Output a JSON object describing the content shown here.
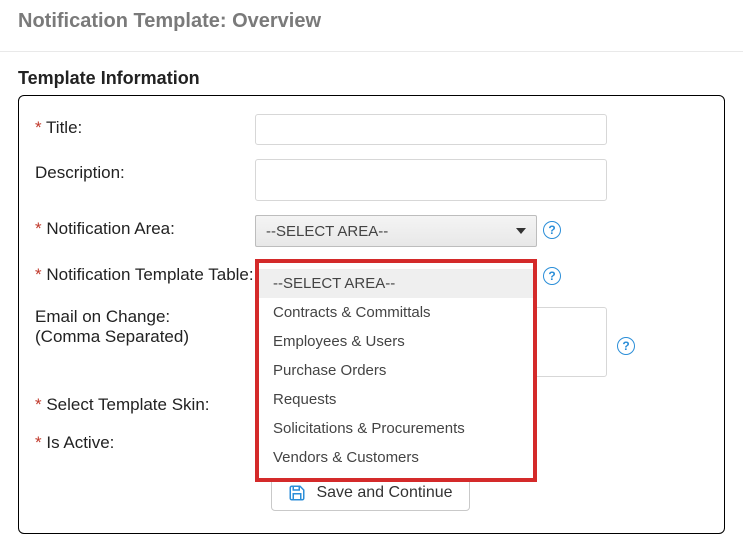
{
  "header": {
    "title": "Notification Template: Overview"
  },
  "section": {
    "title": "Template Information"
  },
  "labels": {
    "title": "Title:",
    "description": "Description:",
    "area": "Notification Area:",
    "templateTable": "Notification Template Table:",
    "emailLine1": "Email on Change:",
    "emailLine2": "(Comma Separated)",
    "skin": "Select Template Skin:",
    "isActive": "Is Active:"
  },
  "fields": {
    "title": {
      "value": "",
      "placeholder": ""
    },
    "description": {
      "value": "",
      "placeholder": ""
    },
    "area": {
      "selectedLabel": "--SELECT AREA--",
      "options": [
        "--SELECT AREA--",
        "Contracts & Committals",
        "Employees & Users",
        "Purchase Orders",
        "Requests",
        "Solicitations & Procurements",
        "Vendors & Customers"
      ],
      "selectedIndex": 0
    },
    "emails": {
      "value": "",
      "placeholder": ""
    }
  },
  "buttons": {
    "save": "Save and Continue"
  },
  "icons": {
    "help": "?"
  }
}
